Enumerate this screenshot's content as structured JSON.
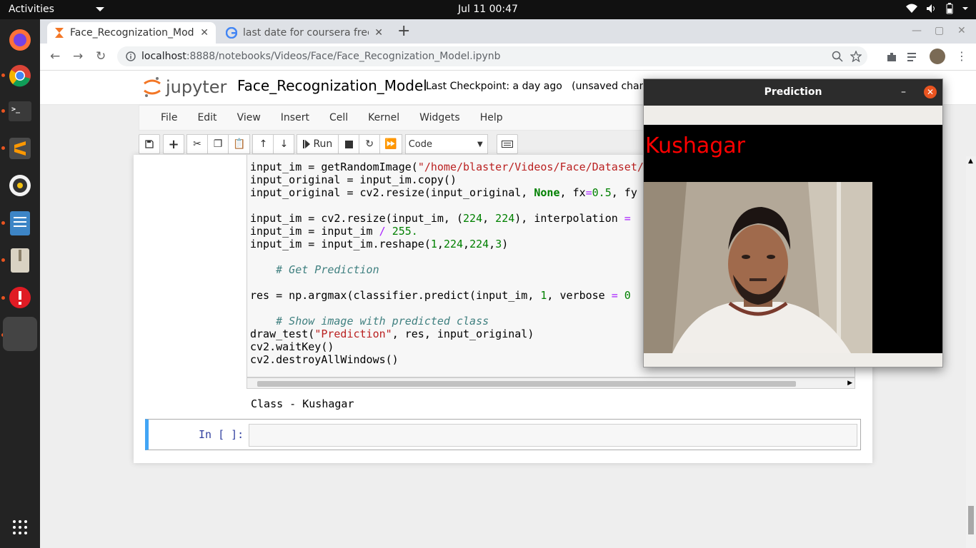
{
  "topbar": {
    "activities": "Activities",
    "clock": "Jul 11  00:47"
  },
  "browser": {
    "tabs": [
      {
        "label": "Face_Recognization_Mod",
        "active": true
      },
      {
        "label": "last date for coursera free",
        "active": false
      }
    ],
    "url_host": "localhost",
    "url_path": ":8888/notebooks/Videos/Face/Face_Recognization_Model.ipynb"
  },
  "jupyter": {
    "logo_text": "jupyter",
    "notebook_title": "Face_Recognization_Model",
    "checkpoint": "Last Checkpoint: a day ago",
    "unsaved": "(unsaved changes)",
    "menus": [
      "File",
      "Edit",
      "View",
      "Insert",
      "Cell",
      "Kernel",
      "Widgets",
      "Help"
    ],
    "toolbar": {
      "run_label": "Run",
      "cell_type": "Code"
    },
    "output": "Class - Kushagar",
    "empty_prompt": "In [ ]:"
  },
  "prediction_window": {
    "title": "Prediction",
    "label": "Kushagar"
  },
  "colors": {
    "accent_cell": "#42a5f5",
    "prediction_text": "#ff0000",
    "ubuntu_orange": "#e95420"
  }
}
